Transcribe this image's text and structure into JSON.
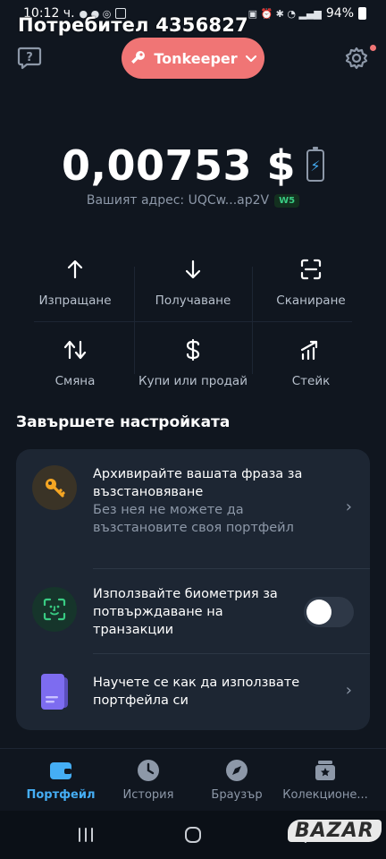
{
  "status_bar": {
    "time": "10:12 ч.",
    "battery": "94%"
  },
  "overlay_title": "Потребител 4356827",
  "header": {
    "wallet_name": "Tonkeeper"
  },
  "balance": {
    "amount": "0,00753 $",
    "address_label": "Вашият адрес: UQCw...ap2V",
    "version_badge": "W5"
  },
  "actions": [
    {
      "label": "Изпращане",
      "icon": "arrow-up-icon"
    },
    {
      "label": "Получаване",
      "icon": "arrow-down-icon"
    },
    {
      "label": "Сканиране",
      "icon": "scan-icon"
    },
    {
      "label": "Смяна",
      "icon": "swap-icon"
    },
    {
      "label": "Купи или продай",
      "icon": "dollar-icon"
    },
    {
      "label": "Стейк",
      "icon": "stake-icon"
    }
  ],
  "setup": {
    "title": "Завършете настройката",
    "items": [
      {
        "title": "Архивирайте вашата фраза за възстановяване",
        "subtitle": "Без нея не можете да възстановите своя портфейл",
        "icon": "key-icon"
      },
      {
        "title": "Използвайте биометрия за потвърждаване на транзакции",
        "icon": "face-scan-icon",
        "toggle_on": false
      },
      {
        "title": "Научете се как да използвате портфейла си",
        "icon": "documents-icon"
      }
    ]
  },
  "tabs": [
    {
      "label": "Портфейл",
      "icon": "wallet-icon",
      "active": true
    },
    {
      "label": "История",
      "icon": "clock-icon",
      "active": false
    },
    {
      "label": "Браузър",
      "icon": "compass-icon",
      "active": false
    },
    {
      "label": "Колекционе...",
      "icon": "collectibles-icon",
      "active": false
    }
  ],
  "watermark": "BAZAR",
  "colors": {
    "background": "#10161f",
    "card": "#1d2633",
    "accent_pink": "#f07575",
    "accent_blue": "#45aef5",
    "secondary_text": "#8d98a8",
    "badge_green": "#39cc83"
  }
}
